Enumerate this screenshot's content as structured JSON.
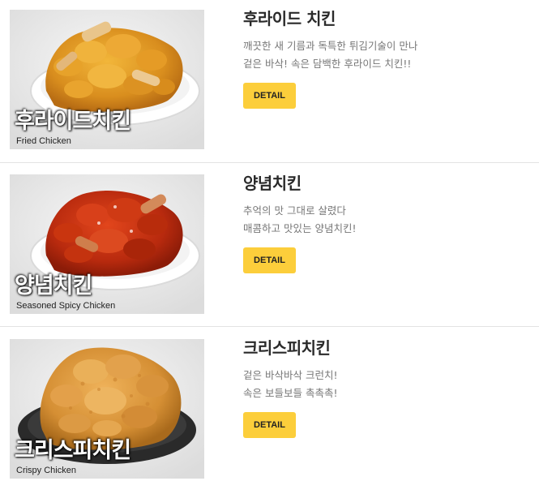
{
  "menu": {
    "items": [
      {
        "name": "후라이드 치킨",
        "desc_line1": "깨끗한 새 기름과 독특한 튀김기술이 만나",
        "desc_line2": "겉은 바삭! 속은 담백한 후라이드 치킨!!",
        "photo_title_ko": "후라이드치킨",
        "photo_title_en": "Fried Chicken",
        "button_label": "DETAIL"
      },
      {
        "name": "양념치킨",
        "desc_line1": "추억의 맛 그대로 살렸다",
        "desc_line2": "매콤하고 맛있는 양념치킨!",
        "photo_title_ko": "양념치킨",
        "photo_title_en": "Seasoned Spicy Chicken",
        "button_label": "DETAIL"
      },
      {
        "name": "크리스피치킨",
        "desc_line1": "겉은 바삭바삭 크런치!",
        "desc_line2": "속은 보들보들 촉촉촉!",
        "photo_title_ko": "크리스피치킨",
        "photo_title_en": "Crispy Chicken",
        "button_label": "DETAIL"
      }
    ]
  },
  "colors": {
    "button_bg": "#fcce3b",
    "title_text": "#2a2a2a",
    "desc_text": "#777777",
    "divider": "#e3e3e3"
  }
}
